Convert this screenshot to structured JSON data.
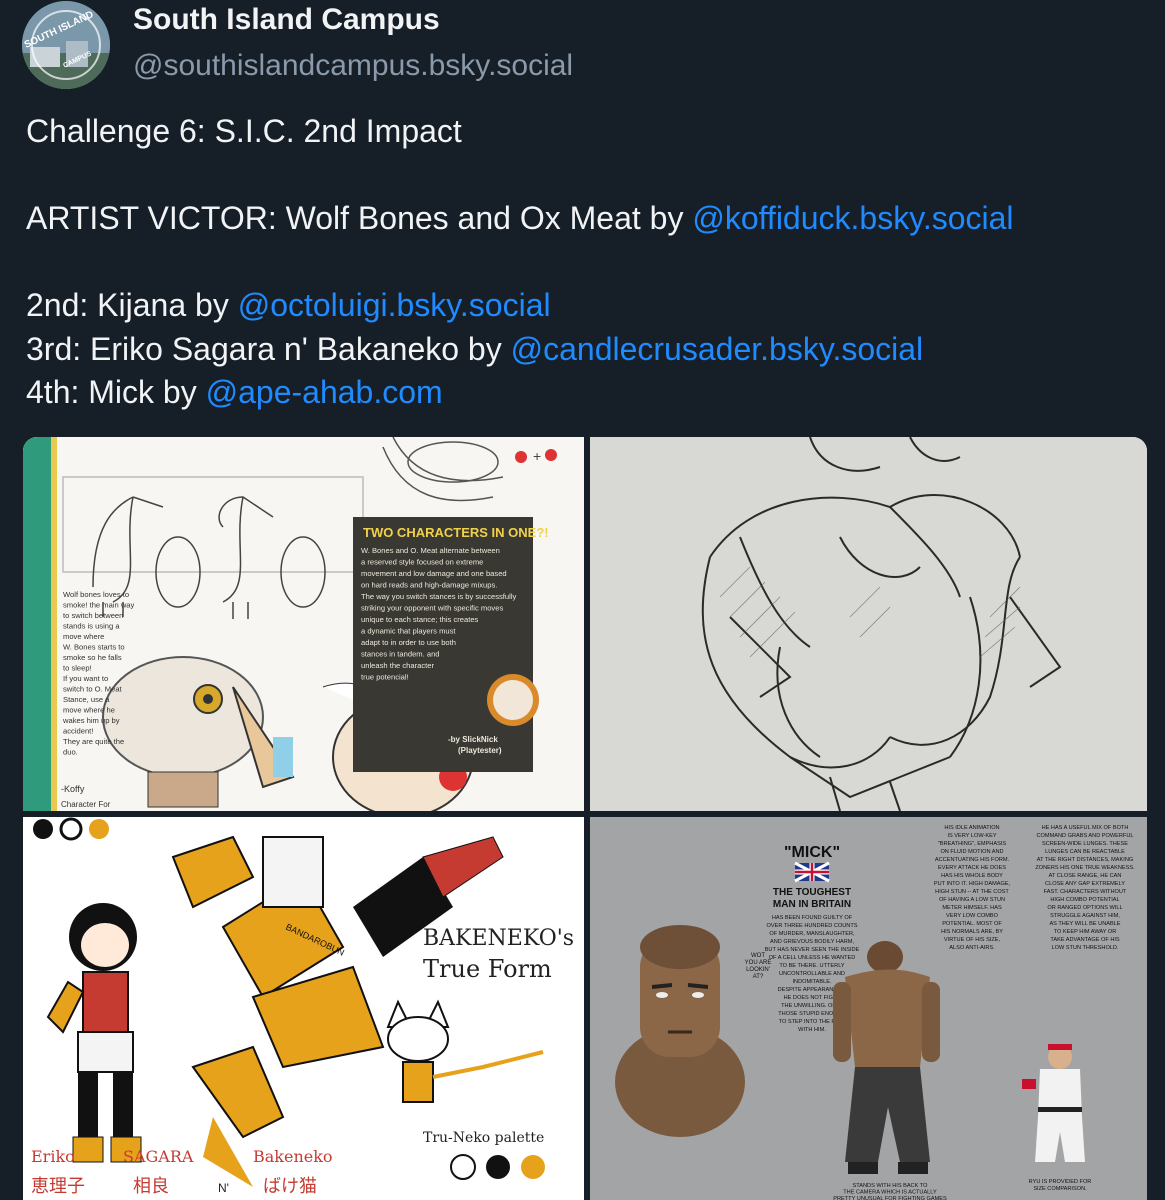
{
  "post": {
    "author": {
      "display_name": "South Island Campus",
      "handle": "@southislandcampus.bsky.social",
      "avatar_text_top": "SOUTH ISLAND",
      "avatar_text_bottom": "CAMPUS"
    },
    "text": {
      "line1": "Challenge 6: S.I.C. 2nd Impact",
      "line2_prefix": "ARTIST VICTOR: Wolf Bones and Ox Meat by ",
      "line2_mention": "@koffiduck.bsky.social",
      "line3_prefix": "2nd: Kijana by ",
      "line3_mention": "@octoluigi.bsky.social",
      "line4_prefix": "3rd: Eriko Sagara n' Bakaneko by ",
      "line4_mention": "@candlecrusader.bsky.social",
      "line5_prefix": "4th: Mick by ",
      "line5_mention": "@ape-ahab.com"
    },
    "images": {
      "image1": {
        "box_title": "TWO CHARACTERS IN ONE?!",
        "box_body": [
          "W. Bones and O. Meat alternate between",
          "a reserved style focused on extreme",
          "movement and low damage and one based",
          "on hard reads and high-damage mixups.",
          "The way you switch stances is by successfully",
          "striking your opponent with specific moves",
          "unique to each stance; this creates",
          "a dynamic that players must",
          "adapt to in order to use both",
          "stances in tandem.  and",
          "unleash the character",
          "true potencial!"
        ],
        "byline": "-by SlickNick",
        "byline_role": "(Playtester)",
        "side_note": [
          "Wolf bones loves to",
          "smoke! the main way",
          "to switch between",
          "stands is using a",
          "move where",
          "W. Bones starts to",
          "smoke so he falls",
          "to sleep!",
          "If you want to",
          "switch to O. Meat",
          "Stance, use a",
          "move where he",
          "wakes him up by",
          "accident!",
          "They are quite the",
          "duo."
        ],
        "signature": "-Koffy",
        "signature_sub": "Character For"
      },
      "image3": {
        "title_line1": "BAKENEKO's",
        "title_line2": "True Form",
        "palette_label": "Tru-Neko palette",
        "name_eriko": "Eriko",
        "name_sagara": "SAGARA",
        "name_n": "N'",
        "name_bakeneko": "Bakeneko",
        "jp_eriko": "恵理子",
        "jp_sagara": "相良",
        "jp_bakeneko": "ばけ猫",
        "tag_text": "BANDAROBUN"
      },
      "image4": {
        "title": "\"MICK\"",
        "subtitle_line1": "THE TOUGHEST",
        "subtitle_line2": "MAN IN BRITAIN",
        "bio": [
          "HAS BEEN FOUND GUILTY OF",
          "OVER THREE HUNDRED COUNTS",
          "OF MURDER, MANSLAUGHTER,",
          "AND GRIEVOUS BODILY HARM,",
          "BUT HAS NEVER SEEN THE INSIDE",
          "OF A CELL UNLESS HE WANTED",
          "TO BE THERE. UTTERLY",
          "UNCONTROLLABLE AND",
          "INDOMITABLE.",
          "DESPITE APPEARANCES,",
          "HE DOES NOT FIGHT",
          "THE UNWILLING. ONLY",
          "THOSE STUPID ENOUGH",
          "TO STEP INTO THE RING",
          "WITH HIM."
        ],
        "col2": [
          "HIS IDLE ANIMATION",
          "IS VERY LOW-KEY",
          "\"BREATHING\", EMPHASIS",
          "ON FLUID MOTION AND",
          "ACCENTUATING HIS FORM.",
          "EVERY ATTACK HE DOES",
          "HAS HIS WHOLE BODY",
          "PUT INTO IT. HIGH DAMAGE,",
          "HIGH STUN -- AT THE COST",
          "OF HAVING A LOW STUN",
          "METER HIMSELF. HAS",
          "VERY LOW COMBO",
          "POTENTIAL.  MOST OF",
          "HIS NORMALS ARE, BY",
          "VIRTUE OF HIS SIZE,",
          "ALSO ANTI-AIRS."
        ],
        "col3": [
          "HE HAS A USEFUL MIX OF BOTH",
          "COMMAND GRABS AND POWERFUL",
          "SCREEN-WIDE LUNGES. THESE",
          "LUNGES CAN BE REACTABLE",
          "AT THE RIGHT DISTANCES, MAKING",
          "ZONERS HIS ONE TRUE WEAKNESS.",
          "AT CLOSE RANGE, HE CAN",
          "CLOSE ANY GAP EXTREMELY",
          "FAST. CHARACTERS WITHOUT",
          "HIGH COMBO POTENTIAL",
          "OR RANGED OPTIONS WILL",
          "STRUGGLE AGAINST HIM,",
          "AS THEY WILL BE UNABLE",
          "TO KEEP HIM AWAY OR",
          "TAKE ADVANTAGE OF HIS",
          "LOW STUN THRESHOLD."
        ],
        "speech": [
          "WOT",
          "YOU ARE",
          "LOOKIN'",
          "AT?"
        ],
        "back_caption": [
          "STANDS WITH HIS BACK TO",
          "THE CAMERA WHICH IS ACTUALLY",
          "PRETTY UNUSUAL FOR FIGHTING GAMES"
        ],
        "ryu_caption": [
          "RYU IS PROVIDED FOR",
          "SIZE COMPARISON."
        ]
      }
    },
    "colors": {
      "background": "#161e27",
      "text": "#f1f3f5",
      "muted": "#8a9aab",
      "link": "#208bfe"
    }
  }
}
